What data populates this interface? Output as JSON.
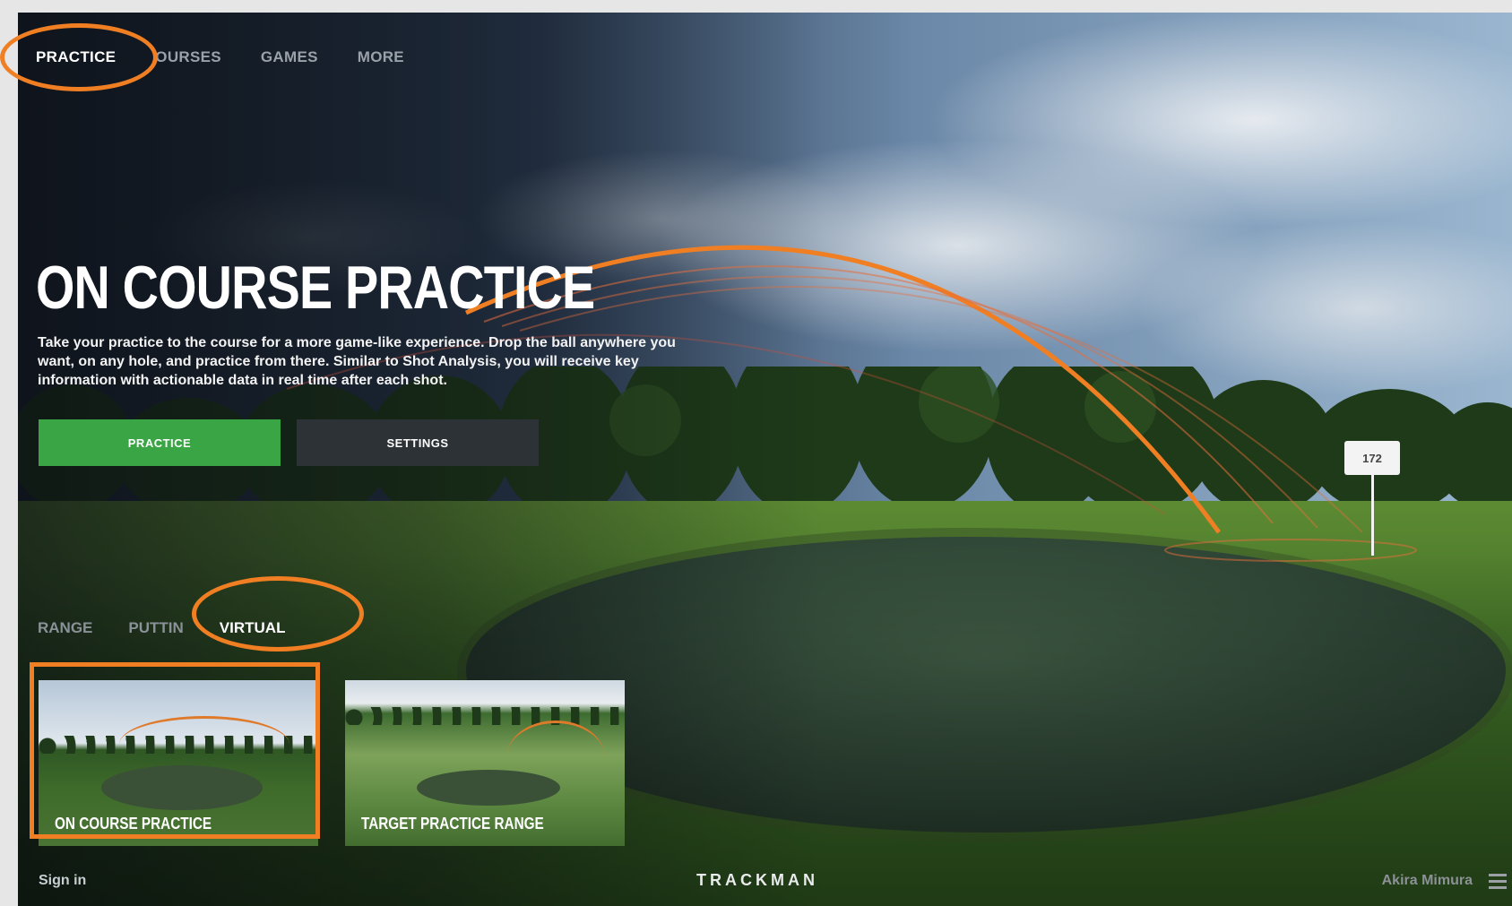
{
  "nav": {
    "items": [
      {
        "label": "PRACTICE",
        "active": true
      },
      {
        "label": "OURSES",
        "active": false
      },
      {
        "label": "GAMES",
        "active": false
      },
      {
        "label": "MORE",
        "active": false
      }
    ]
  },
  "hero": {
    "title": "ON COURSE PRACTICE",
    "description": "Take your practice to the course for a more game-like experience. Drop the ball anywhere you want, on any hole, and practice from there. Similar to Shot Analysis, you will receive key information with actionable data in real time after each shot.",
    "practice_button": "PRACTICE",
    "settings_button": "SETTINGS"
  },
  "pin": {
    "label": "172"
  },
  "subnav": {
    "items": [
      {
        "label": "RANGE",
        "active": false
      },
      {
        "label": "PUTTIN",
        "active": false
      },
      {
        "label": "VIRTUAL",
        "active": true
      }
    ]
  },
  "tiles": [
    {
      "label": "ON COURSE PRACTICE",
      "selected": true
    },
    {
      "label": "TARGET PRACTICE RANGE",
      "selected": false
    }
  ],
  "footer": {
    "signin": "Sign in",
    "brand": "TRACKMAN",
    "user": "Akira Mimura"
  },
  "colors": {
    "accent_highlight": "#f07f24",
    "primary_button": "#3aa544",
    "secondary_button": "#2d3236"
  }
}
